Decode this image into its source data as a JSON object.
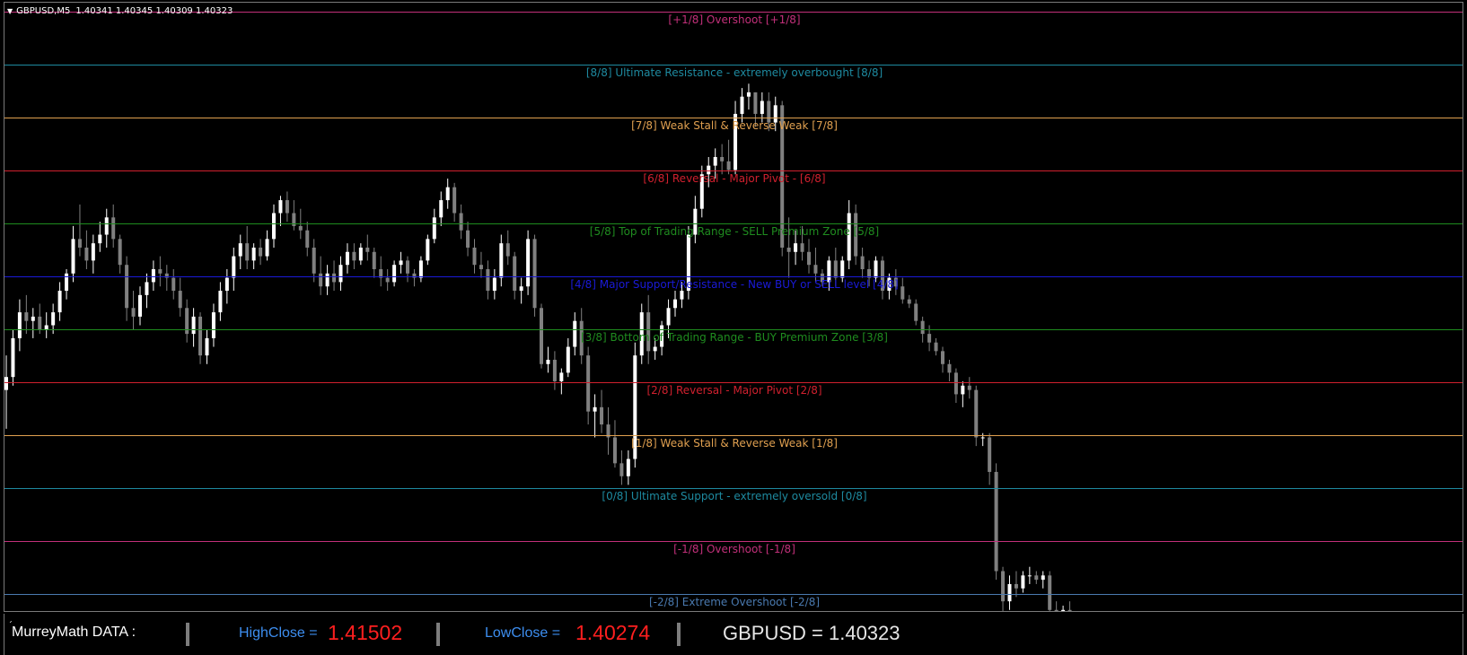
{
  "header": {
    "symbol": "GBPUSD,M5",
    "open": "1.40341",
    "high": "1.40345",
    "low": "1.40309",
    "close": "1.40323"
  },
  "levels": [
    {
      "label": "[+1/8] Overshoot [+1/8]",
      "color": "#c2307a"
    },
    {
      "label": "[8/8] Ultimate Resistance - extremely overbought [8/8]",
      "color": "#1e8aa0"
    },
    {
      "label": "[7/8] Weak Stall & Reverse Weak [7/8]",
      "color": "#e0a050"
    },
    {
      "label": "[6/8] Reversal - Major Pivot - [6/8]",
      "color": "#d0202e"
    },
    {
      "label": "[5/8] Top of Trading Range - SELL Premium Zone [5/8]",
      "color": "#1f8c1f"
    },
    {
      "label": "[4/8] Major Support/Resistance - New BUY or SELL level [4/8]",
      "color": "#1a1ad8"
    },
    {
      "label": "[3/8] Bottom of Trading Range - BUY Premium Zone [3/8]",
      "color": "#1f8c1f"
    },
    {
      "label": "[2/8] Reversal - Major Pivot [2/8]",
      "color": "#d0202e"
    },
    {
      "label": "[1/8] Weak Stall & Reverse Weak [1/8]",
      "color": "#e0a050"
    },
    {
      "label": "[0/8] Ultimate Support - extremely oversold [0/8]",
      "color": "#1e8aa0"
    },
    {
      "label": "[-1/8] Overshoot [-1/8]",
      "color": "#c2307a"
    },
    {
      "label": "[-2/8] Extreme Overshoot [-2/8]",
      "color": "#4a7ab0"
    }
  ],
  "databar": {
    "title": "MurreyMath DATA :",
    "high_label": "HighClose  =",
    "high_value": "1.41502",
    "low_label": "LowClose  =",
    "low_value": "1.40274",
    "ticker": "GBPUSD = 1.40323"
  },
  "colors": {
    "bull_candle": "#ffffff",
    "bear_candle": "#808080",
    "background": "#000000",
    "label_blue": "#3d8ef0",
    "value_red": "#ff1f1f"
  },
  "chart_data": {
    "type": "candlestick",
    "series": [
      {
        "o": 1.4087,
        "h": 1.4095,
        "l": 1.4078,
        "c": 1.409
      },
      {
        "o": 1.409,
        "h": 1.4101,
        "l": 1.4088,
        "c": 1.4099
      },
      {
        "o": 1.4099,
        "h": 1.4108,
        "l": 1.4096,
        "c": 1.4105
      },
      {
        "o": 1.4105,
        "h": 1.4109,
        "l": 1.41,
        "c": 1.4103
      },
      {
        "o": 1.4103,
        "h": 1.4106,
        "l": 1.4099,
        "c": 1.4104
      },
      {
        "o": 1.4104,
        "h": 1.4107,
        "l": 1.41,
        "c": 1.4101
      },
      {
        "o": 1.4101,
        "h": 1.4105,
        "l": 1.4099,
        "c": 1.4102
      },
      {
        "o": 1.4102,
        "h": 1.4107,
        "l": 1.41,
        "c": 1.4105
      },
      {
        "o": 1.4105,
        "h": 1.4112,
        "l": 1.4103,
        "c": 1.411
      },
      {
        "o": 1.411,
        "h": 1.4115,
        "l": 1.4108,
        "c": 1.4114
      },
      {
        "o": 1.4114,
        "h": 1.4125,
        "l": 1.4112,
        "c": 1.4122
      },
      {
        "o": 1.4122,
        "h": 1.413,
        "l": 1.4118,
        "c": 1.412
      },
      {
        "o": 1.412,
        "h": 1.4124,
        "l": 1.4115,
        "c": 1.4117
      },
      {
        "o": 1.4117,
        "h": 1.4123,
        "l": 1.4114,
        "c": 1.4121
      },
      {
        "o": 1.4121,
        "h": 1.4126,
        "l": 1.4119,
        "c": 1.4123
      },
      {
        "o": 1.4123,
        "h": 1.4129,
        "l": 1.412,
        "c": 1.4127
      },
      {
        "o": 1.4127,
        "h": 1.413,
        "l": 1.412,
        "c": 1.4122
      },
      {
        "o": 1.4122,
        "h": 1.4123,
        "l": 1.4114,
        "c": 1.4116
      },
      {
        "o": 1.4116,
        "h": 1.4118,
        "l": 1.4103,
        "c": 1.4106
      },
      {
        "o": 1.4106,
        "h": 1.411,
        "l": 1.4101,
        "c": 1.4104
      },
      {
        "o": 1.4104,
        "h": 1.4111,
        "l": 1.4102,
        "c": 1.4109
      },
      {
        "o": 1.4109,
        "h": 1.4114,
        "l": 1.4106,
        "c": 1.4112
      },
      {
        "o": 1.4112,
        "h": 1.4117,
        "l": 1.411,
        "c": 1.4115
      },
      {
        "o": 1.4115,
        "h": 1.4118,
        "l": 1.4111,
        "c": 1.4114
      },
      {
        "o": 1.4114,
        "h": 1.4116,
        "l": 1.411,
        "c": 1.4113
      },
      {
        "o": 1.4113,
        "h": 1.4115,
        "l": 1.4108,
        "c": 1.411
      },
      {
        "o": 1.411,
        "h": 1.4113,
        "l": 1.4104,
        "c": 1.4106
      },
      {
        "o": 1.4106,
        "h": 1.4108,
        "l": 1.4098,
        "c": 1.41
      },
      {
        "o": 1.41,
        "h": 1.4106,
        "l": 1.4097,
        "c": 1.4104
      },
      {
        "o": 1.4104,
        "h": 1.4105,
        "l": 1.4093,
        "c": 1.4095
      },
      {
        "o": 1.4095,
        "h": 1.4101,
        "l": 1.4093,
        "c": 1.4099
      },
      {
        "o": 1.4099,
        "h": 1.4107,
        "l": 1.4097,
        "c": 1.4105
      },
      {
        "o": 1.4105,
        "h": 1.4112,
        "l": 1.4103,
        "c": 1.411
      },
      {
        "o": 1.411,
        "h": 1.4115,
        "l": 1.4107,
        "c": 1.4113
      },
      {
        "o": 1.4113,
        "h": 1.412,
        "l": 1.411,
        "c": 1.4118
      },
      {
        "o": 1.4118,
        "h": 1.4123,
        "l": 1.4115,
        "c": 1.4121
      },
      {
        "o": 1.4121,
        "h": 1.4125,
        "l": 1.4115,
        "c": 1.4117
      },
      {
        "o": 1.4117,
        "h": 1.4121,
        "l": 1.4115,
        "c": 1.412
      },
      {
        "o": 1.412,
        "h": 1.4122,
        "l": 1.4116,
        "c": 1.4118
      },
      {
        "o": 1.4118,
        "h": 1.4124,
        "l": 1.4117,
        "c": 1.4122
      },
      {
        "o": 1.4122,
        "h": 1.413,
        "l": 1.412,
        "c": 1.4128
      },
      {
        "o": 1.4128,
        "h": 1.4132,
        "l": 1.4125,
        "c": 1.4131
      },
      {
        "o": 1.4131,
        "h": 1.4133,
        "l": 1.4126,
        "c": 1.4128
      },
      {
        "o": 1.4128,
        "h": 1.4131,
        "l": 1.4124,
        "c": 1.4125
      },
      {
        "o": 1.4125,
        "h": 1.4129,
        "l": 1.4122,
        "c": 1.4124
      },
      {
        "o": 1.4124,
        "h": 1.4126,
        "l": 1.4118,
        "c": 1.412
      },
      {
        "o": 1.412,
        "h": 1.4122,
        "l": 1.4112,
        "c": 1.4114
      },
      {
        "o": 1.4114,
        "h": 1.4118,
        "l": 1.4109,
        "c": 1.4111
      },
      {
        "o": 1.4111,
        "h": 1.4116,
        "l": 1.4109,
        "c": 1.4114
      },
      {
        "o": 1.4114,
        "h": 1.4117,
        "l": 1.411,
        "c": 1.4112
      },
      {
        "o": 1.4112,
        "h": 1.4118,
        "l": 1.411,
        "c": 1.4116
      },
      {
        "o": 1.4116,
        "h": 1.4121,
        "l": 1.4114,
        "c": 1.4119
      },
      {
        "o": 1.4119,
        "h": 1.4121,
        "l": 1.4115,
        "c": 1.4117
      },
      {
        "o": 1.4117,
        "h": 1.4121,
        "l": 1.4116,
        "c": 1.412
      },
      {
        "o": 1.412,
        "h": 1.4123,
        "l": 1.4117,
        "c": 1.4119
      },
      {
        "o": 1.4119,
        "h": 1.412,
        "l": 1.4113,
        "c": 1.4115
      },
      {
        "o": 1.4115,
        "h": 1.4118,
        "l": 1.4111,
        "c": 1.4113
      },
      {
        "o": 1.4113,
        "h": 1.4115,
        "l": 1.411,
        "c": 1.4112
      },
      {
        "o": 1.4112,
        "h": 1.4117,
        "l": 1.4111,
        "c": 1.4116
      },
      {
        "o": 1.4116,
        "h": 1.4119,
        "l": 1.4114,
        "c": 1.4117
      },
      {
        "o": 1.4117,
        "h": 1.4118,
        "l": 1.4112,
        "c": 1.4114
      },
      {
        "o": 1.4114,
        "h": 1.4115,
        "l": 1.4111,
        "c": 1.4113
      },
      {
        "o": 1.4113,
        "h": 1.4118,
        "l": 1.4112,
        "c": 1.4117
      },
      {
        "o": 1.4117,
        "h": 1.4123,
        "l": 1.4116,
        "c": 1.4122
      },
      {
        "o": 1.4122,
        "h": 1.4129,
        "l": 1.4121,
        "c": 1.4127
      },
      {
        "o": 1.4127,
        "h": 1.4133,
        "l": 1.4125,
        "c": 1.4131
      },
      {
        "o": 1.4131,
        "h": 1.4136,
        "l": 1.4129,
        "c": 1.4134
      },
      {
        "o": 1.4134,
        "h": 1.4135,
        "l": 1.4126,
        "c": 1.4128
      },
      {
        "o": 1.4128,
        "h": 1.413,
        "l": 1.4122,
        "c": 1.4124
      },
      {
        "o": 1.4124,
        "h": 1.4126,
        "l": 1.4118,
        "c": 1.412
      },
      {
        "o": 1.412,
        "h": 1.4122,
        "l": 1.4114,
        "c": 1.4116
      },
      {
        "o": 1.4116,
        "h": 1.4119,
        "l": 1.4113,
        "c": 1.4115
      },
      {
        "o": 1.4115,
        "h": 1.4117,
        "l": 1.4108,
        "c": 1.411
      },
      {
        "o": 1.411,
        "h": 1.4115,
        "l": 1.4108,
        "c": 1.4113
      },
      {
        "o": 1.4113,
        "h": 1.4123,
        "l": 1.4111,
        "c": 1.4121
      },
      {
        "o": 1.4121,
        "h": 1.4124,
        "l": 1.4116,
        "c": 1.4118
      },
      {
        "o": 1.4118,
        "h": 1.4119,
        "l": 1.4108,
        "c": 1.411
      },
      {
        "o": 1.411,
        "h": 1.4113,
        "l": 1.4107,
        "c": 1.4111
      },
      {
        "o": 1.4111,
        "h": 1.4124,
        "l": 1.4109,
        "c": 1.4122
      },
      {
        "o": 1.4122,
        "h": 1.4123,
        "l": 1.4104,
        "c": 1.4106
      },
      {
        "o": 1.4106,
        "h": 1.4107,
        "l": 1.4092,
        "c": 1.4093
      },
      {
        "o": 1.4093,
        "h": 1.4097,
        "l": 1.4091,
        "c": 1.4094
      },
      {
        "o": 1.4094,
        "h": 1.4096,
        "l": 1.4087,
        "c": 1.4089
      },
      {
        "o": 1.4089,
        "h": 1.4092,
        "l": 1.4086,
        "c": 1.4091
      },
      {
        "o": 1.4091,
        "h": 1.4099,
        "l": 1.409,
        "c": 1.4097
      },
      {
        "o": 1.4097,
        "h": 1.4105,
        "l": 1.4095,
        "c": 1.4103
      },
      {
        "o": 1.4103,
        "h": 1.4106,
        "l": 1.4093,
        "c": 1.4095
      },
      {
        "o": 1.4095,
        "h": 1.4097,
        "l": 1.4079,
        "c": 1.4082
      },
      {
        "o": 1.4082,
        "h": 1.4086,
        "l": 1.4076,
        "c": 1.4083
      },
      {
        "o": 1.4083,
        "h": 1.4087,
        "l": 1.4077,
        "c": 1.4079
      },
      {
        "o": 1.4079,
        "h": 1.4083,
        "l": 1.4072,
        "c": 1.4076
      },
      {
        "o": 1.4076,
        "h": 1.408,
        "l": 1.4069,
        "c": 1.407
      },
      {
        "o": 1.407,
        "h": 1.4073,
        "l": 1.4065,
        "c": 1.4067
      },
      {
        "o": 1.4067,
        "h": 1.4073,
        "l": 1.4065,
        "c": 1.4071
      },
      {
        "o": 1.4071,
        "h": 1.4098,
        "l": 1.4069,
        "c": 1.4095
      },
      {
        "o": 1.4095,
        "h": 1.4107,
        "l": 1.4093,
        "c": 1.4105
      },
      {
        "o": 1.4105,
        "h": 1.4109,
        "l": 1.4093,
        "c": 1.4096
      },
      {
        "o": 1.4096,
        "h": 1.4099,
        "l": 1.4094,
        "c": 1.4097
      },
      {
        "o": 1.4097,
        "h": 1.4103,
        "l": 1.4095,
        "c": 1.4102
      },
      {
        "o": 1.4102,
        "h": 1.4108,
        "l": 1.4099,
        "c": 1.4106
      },
      {
        "o": 1.4106,
        "h": 1.411,
        "l": 1.4104,
        "c": 1.4108
      },
      {
        "o": 1.4108,
        "h": 1.4112,
        "l": 1.4106,
        "c": 1.411
      },
      {
        "o": 1.411,
        "h": 1.4125,
        "l": 1.4108,
        "c": 1.4123
      },
      {
        "o": 1.4123,
        "h": 1.4132,
        "l": 1.4121,
        "c": 1.4129
      },
      {
        "o": 1.4129,
        "h": 1.4139,
        "l": 1.4127,
        "c": 1.4137
      },
      {
        "o": 1.4137,
        "h": 1.4141,
        "l": 1.4134,
        "c": 1.4139
      },
      {
        "o": 1.4139,
        "h": 1.4143,
        "l": 1.4136,
        "c": 1.4141
      },
      {
        "o": 1.4141,
        "h": 1.4144,
        "l": 1.4137,
        "c": 1.414
      },
      {
        "o": 1.414,
        "h": 1.4145,
        "l": 1.4137,
        "c": 1.4138
      },
      {
        "o": 1.4138,
        "h": 1.4154,
        "l": 1.4137,
        "c": 1.4151
      },
      {
        "o": 1.4151,
        "h": 1.4157,
        "l": 1.4149,
        "c": 1.4155
      },
      {
        "o": 1.4155,
        "h": 1.4158,
        "l": 1.4152,
        "c": 1.4156
      },
      {
        "o": 1.4156,
        "h": 1.4156,
        "l": 1.4148,
        "c": 1.4151
      },
      {
        "o": 1.4151,
        "h": 1.4156,
        "l": 1.4149,
        "c": 1.4154
      },
      {
        "o": 1.4154,
        "h": 1.4156,
        "l": 1.4147,
        "c": 1.4149
      },
      {
        "o": 1.4149,
        "h": 1.4155,
        "l": 1.4147,
        "c": 1.4153
      },
      {
        "o": 1.4153,
        "h": 1.4154,
        "l": 1.4118,
        "c": 1.412
      },
      {
        "o": 1.412,
        "h": 1.4127,
        "l": 1.4113,
        "c": 1.4119
      },
      {
        "o": 1.4119,
        "h": 1.4124,
        "l": 1.4116,
        "c": 1.4121
      },
      {
        "o": 1.4121,
        "h": 1.4125,
        "l": 1.4117,
        "c": 1.4119
      },
      {
        "o": 1.4119,
        "h": 1.4122,
        "l": 1.4114,
        "c": 1.4116
      },
      {
        "o": 1.4116,
        "h": 1.412,
        "l": 1.4112,
        "c": 1.4114
      },
      {
        "o": 1.4114,
        "h": 1.4115,
        "l": 1.4111,
        "c": 1.4112
      },
      {
        "o": 1.4112,
        "h": 1.4118,
        "l": 1.411,
        "c": 1.4117
      },
      {
        "o": 1.4117,
        "h": 1.412,
        "l": 1.4111,
        "c": 1.4113
      },
      {
        "o": 1.4113,
        "h": 1.4118,
        "l": 1.4112,
        "c": 1.4117
      },
      {
        "o": 1.4117,
        "h": 1.4131,
        "l": 1.4115,
        "c": 1.4128
      },
      {
        "o": 1.4128,
        "h": 1.413,
        "l": 1.4116,
        "c": 1.4118
      },
      {
        "o": 1.4118,
        "h": 1.412,
        "l": 1.4113,
        "c": 1.4115
      },
      {
        "o": 1.4115,
        "h": 1.4117,
        "l": 1.4111,
        "c": 1.4113
      },
      {
        "o": 1.4113,
        "h": 1.4118,
        "l": 1.4112,
        "c": 1.4117
      },
      {
        "o": 1.4117,
        "h": 1.4118,
        "l": 1.4108,
        "c": 1.411
      },
      {
        "o": 1.411,
        "h": 1.4114,
        "l": 1.4108,
        "c": 1.4113
      },
      {
        "o": 1.4113,
        "h": 1.4115,
        "l": 1.4109,
        "c": 1.4111
      },
      {
        "o": 1.4111,
        "h": 1.4113,
        "l": 1.4107,
        "c": 1.4108
      },
      {
        "o": 1.4108,
        "h": 1.4109,
        "l": 1.4106,
        "c": 1.4107
      },
      {
        "o": 1.4107,
        "h": 1.4108,
        "l": 1.4102,
        "c": 1.4103
      },
      {
        "o": 1.4103,
        "h": 1.4104,
        "l": 1.4098,
        "c": 1.41
      },
      {
        "o": 1.41,
        "h": 1.4102,
        "l": 1.4096,
        "c": 1.4098
      },
      {
        "o": 1.4098,
        "h": 1.4099,
        "l": 1.4095,
        "c": 1.4096
      },
      {
        "o": 1.4096,
        "h": 1.4097,
        "l": 1.4091,
        "c": 1.4093
      },
      {
        "o": 1.4093,
        "h": 1.4094,
        "l": 1.4089,
        "c": 1.4091
      },
      {
        "o": 1.4091,
        "h": 1.4092,
        "l": 1.4084,
        "c": 1.4086
      },
      {
        "o": 1.4086,
        "h": 1.4089,
        "l": 1.4083,
        "c": 1.4088
      },
      {
        "o": 1.4088,
        "h": 1.409,
        "l": 1.4085,
        "c": 1.4087
      },
      {
        "o": 1.4087,
        "h": 1.4088,
        "l": 1.4074,
        "c": 1.4076
      },
      {
        "o": 1.4076,
        "h": 1.4077,
        "l": 1.4074,
        "c": 1.4076
      },
      {
        "o": 1.4076,
        "h": 1.4077,
        "l": 1.4065,
        "c": 1.4068
      },
      {
        "o": 1.4068,
        "h": 1.407,
        "l": 1.4043,
        "c": 1.4045
      },
      {
        "o": 1.4045,
        "h": 1.4046,
        "l": 1.403,
        "c": 1.4038
      },
      {
        "o": 1.4038,
        "h": 1.4044,
        "l": 1.4036,
        "c": 1.4042
      },
      {
        "o": 1.4042,
        "h": 1.4045,
        "l": 1.4039,
        "c": 1.4041
      },
      {
        "o": 1.4041,
        "h": 1.4045,
        "l": 1.404,
        "c": 1.4044
      },
      {
        "o": 1.4044,
        "h": 1.4046,
        "l": 1.4042,
        "c": 1.4044
      },
      {
        "o": 1.4044,
        "h": 1.4045,
        "l": 1.4042,
        "c": 1.4043
      },
      {
        "o": 1.4043,
        "h": 1.4045,
        "l": 1.4041,
        "c": 1.4044
      },
      {
        "o": 1.4044,
        "h": 1.4045,
        "l": 1.4034,
        "c": 1.4036
      },
      {
        "o": 1.4036,
        "h": 1.4038,
        "l": 1.4032,
        "c": 1.4034
      },
      {
        "o": 1.4034,
        "h": 1.4037,
        "l": 1.4033,
        "c": 1.4036
      },
      {
        "o": 1.4036,
        "h": 1.4038,
        "l": 1.4031,
        "c": 1.4032
      },
      {
        "o": 1.4032,
        "h": 1.4033,
        "l": 1.4027,
        "c": 1.4029
      },
      {
        "o": 1.4029,
        "h": 1.4033,
        "l": 1.4025,
        "c": 1.4032
      },
      {
        "o": 1.40341,
        "h": 1.40345,
        "l": 1.40309,
        "c": 1.40323
      }
    ],
    "mm_levels": [
      1.41747,
      1.41625,
      1.41502,
      1.41379,
      1.41256,
      1.41134,
      1.41011,
      1.40888,
      1.40765,
      1.40642,
      1.4052,
      1.40397
    ],
    "ylim": [
      1.4033,
      1.4179
    ]
  }
}
